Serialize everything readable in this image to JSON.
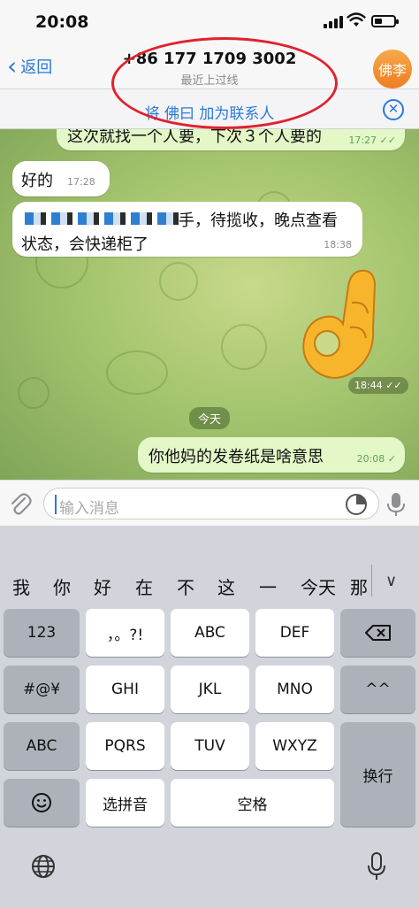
{
  "status": {
    "time": "20:08"
  },
  "nav": {
    "back_label": "返回",
    "phone": "+86 177 1709 3002",
    "last_seen": "最近上过线",
    "avatar_text": "佛李"
  },
  "add_contact": {
    "label": "将 佛曰 加为联系人"
  },
  "messages": [
    {
      "text": "这次就找一个人要，下次３个人要的",
      "time": "17:27",
      "side": "out"
    },
    {
      "text": "好的",
      "time": "17:28",
      "side": "in"
    },
    {
      "text_line1": "手，待揽收，晚点查看",
      "text_line2": "状态，会快递柜了",
      "time": "18:38",
      "side": "in"
    },
    {
      "time": "18:44",
      "side": "out",
      "kind": "sticker"
    },
    {
      "text": "你他妈的发卷纸是啥意思",
      "time": "20:08",
      "side": "out"
    }
  ],
  "day_label": "今天",
  "input": {
    "placeholder": "输入消息"
  },
  "keyboard": {
    "candidates": [
      "我",
      "你",
      "好",
      "在",
      "不",
      "这",
      "一",
      "今天",
      "那"
    ],
    "keys": {
      "num": "123",
      "punct": "，。?!",
      "abc1": "ABC",
      "def": "DEF",
      "symbols": "#@¥",
      "ghi": "GHI",
      "jkl": "JKL",
      "mno": "MNO",
      "emoticon": "^^",
      "abc_mode": "ABC",
      "pqrs": "PQRS",
      "tuv": "TUV",
      "wxyz": "WXYZ",
      "newline": "换行",
      "pinyin": "选拼音",
      "space": "空格"
    }
  }
}
